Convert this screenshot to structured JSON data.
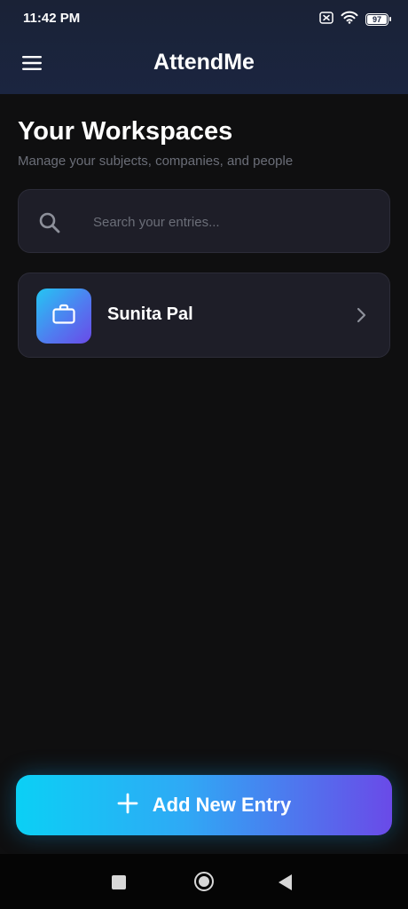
{
  "status_bar": {
    "time": "11:42 PM",
    "battery_level": "97",
    "icons": [
      "sim-off-icon",
      "wifi-icon",
      "battery-icon"
    ]
  },
  "header": {
    "title": "AttendMe",
    "menu_icon": "hamburger-menu-icon"
  },
  "main": {
    "title": "Your Workspaces",
    "subtitle": "Manage your subjects, companies, and people"
  },
  "search": {
    "placeholder": "Search your entries...",
    "value": "",
    "icon": "search-icon"
  },
  "workspaces": [
    {
      "name": "Sunita Pal",
      "icon": "briefcase-icon"
    }
  ],
  "actions": {
    "add_label": "Add New Entry",
    "add_icon": "plus-icon"
  },
  "system_nav": {
    "buttons": [
      "recents",
      "home",
      "back"
    ]
  },
  "colors": {
    "background": "#0f0f10",
    "header_bg": "#1b2540",
    "card_bg": "#1e1e28",
    "accent_start": "#0bd0f5",
    "accent_end": "#6a4ae8",
    "muted_text": "#6b6e78"
  }
}
